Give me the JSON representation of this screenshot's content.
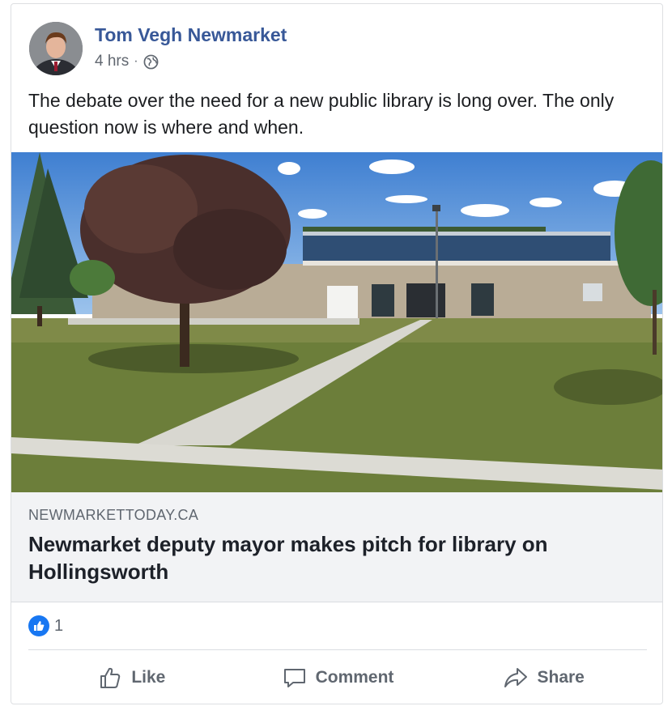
{
  "post": {
    "author": "Tom Vegh Newmarket",
    "time": "4 hrs",
    "separator": "·",
    "privacy_icon": "globe-icon",
    "text": "The debate over the need for a new public library is long over. The only question now is where and when."
  },
  "link_preview": {
    "domain": "NEWMARKETTODAY.CA",
    "title": "Newmarket deputy mayor makes pitch for library on Hollingsworth"
  },
  "reactions": {
    "icon": "like-reaction-icon",
    "count": "1"
  },
  "actions": {
    "like_label": "Like",
    "comment_label": "Comment",
    "share_label": "Share"
  },
  "colors": {
    "author_link": "#385898",
    "like_blue": "#1877f2",
    "action_gray": "#606770"
  }
}
